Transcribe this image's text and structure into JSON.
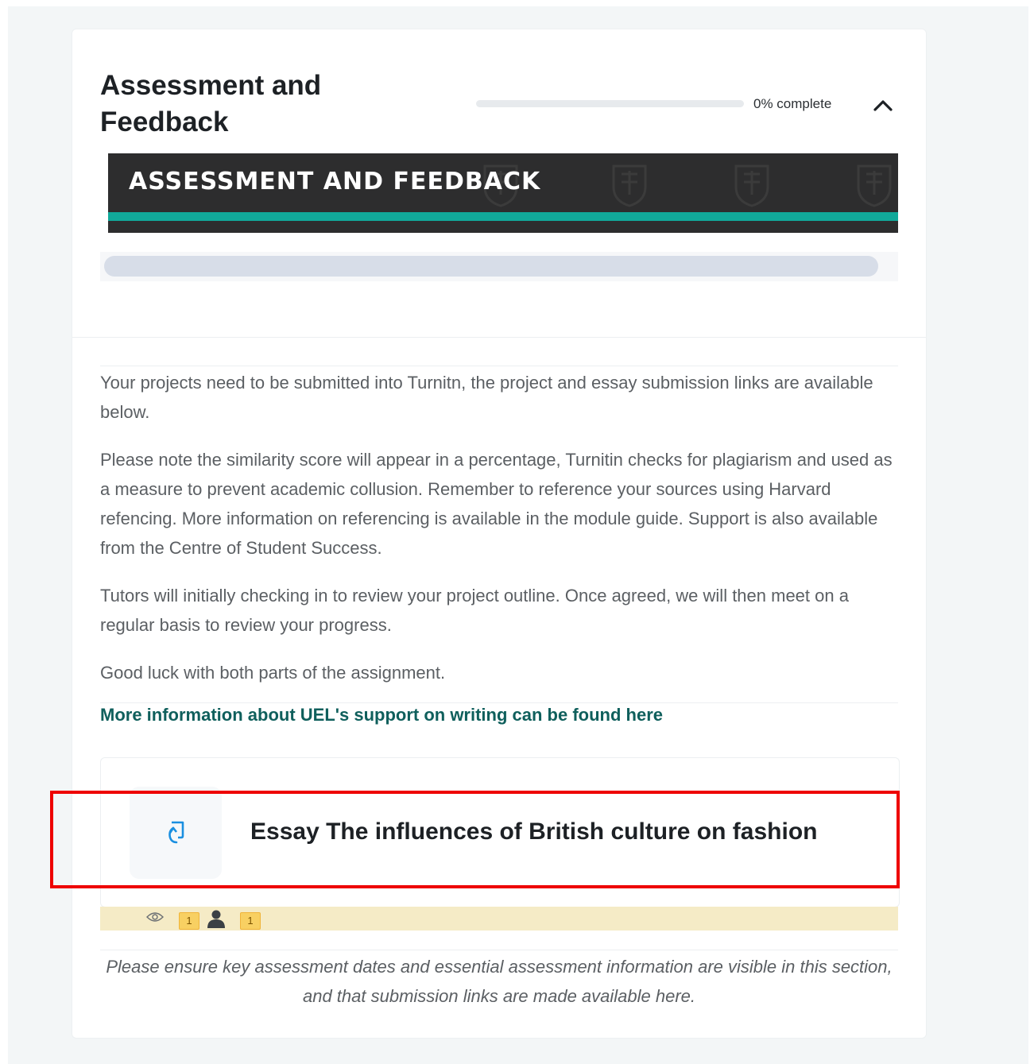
{
  "section": {
    "title": "Assessment and Feedback",
    "progress_label": "0% complete",
    "progress_fraction": 0,
    "toggle_icon": "chevron-up-icon"
  },
  "banner": {
    "text": "ASSESSMENT AND FEEDBACK"
  },
  "summary": {
    "paragraphs": [
      "Your projects need to be submitted into Turnitn, the project and essay submission links are available below.",
      "Please note the similarity score will appear in a percentage, Turnitin checks for plagiarism and used as a measure to prevent academic collusion. Remember to reference your sources using Harvard refencing. More information on referencing is available in the module guide. Support is also available from the Centre of Student Success.",
      "Tutors will initially checking in to review your project outline. Once agreed, we will then meet on a regular basis to review your progress.",
      "Good luck with both parts of the assignment."
    ],
    "link_text": "More information about UEL's support on writing can be found here"
  },
  "activity": {
    "icon": "turnitin-assignment-icon",
    "name": "Essay The influences of British culture on fashion",
    "views_icon": "eye-icon",
    "views_count": "1",
    "users_icon": "user-icon",
    "users_count": "1"
  },
  "note": {
    "text": "Please ensure key assessment dates and essential assessment information are visible in this section, and that submission links are made available here."
  },
  "colors": {
    "accent": "#0f5f5c",
    "banner_bg": "#2d2d2e",
    "banner_stripe": "#11a99a",
    "highlight": "#ee0000",
    "footer_bg": "#f5ebc6"
  }
}
